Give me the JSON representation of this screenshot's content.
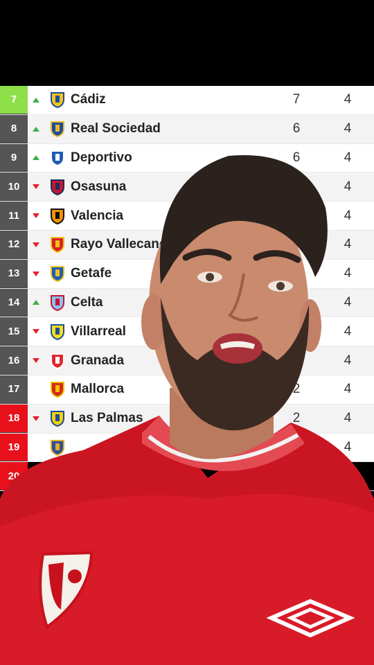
{
  "standings": [
    {
      "pos": "7",
      "trend": "up",
      "team": "Cádiz",
      "pts": "7",
      "pj": "4",
      "zone": "green",
      "crest_color": "#f4c21b",
      "crest_accent": "#1a4e9c"
    },
    {
      "pos": "8",
      "trend": "up",
      "team": "Real Sociedad",
      "pts": "6",
      "pj": "4",
      "zone": "none",
      "crest_color": "#1d4e9e",
      "crest_accent": "#e9b92a"
    },
    {
      "pos": "9",
      "trend": "up",
      "team": "Deportivo",
      "pts": "6",
      "pj": "4",
      "zone": "none",
      "crest_color": "#1d5bb8",
      "crest_accent": "#ffffff"
    },
    {
      "pos": "10",
      "trend": "down",
      "team": "Osasuna",
      "pts": "",
      "pj": "4",
      "zone": "none",
      "crest_color": "#c4162e",
      "crest_accent": "#1b2d5e"
    },
    {
      "pos": "11",
      "trend": "down",
      "team": "Valencia",
      "pts": "",
      "pj": "4",
      "zone": "none",
      "crest_color": "#f39200",
      "crest_accent": "#111111"
    },
    {
      "pos": "12",
      "trend": "down",
      "team": "Rayo Vallecano",
      "pts": "",
      "pj": "4",
      "zone": "none",
      "crest_color": "#d8202c",
      "crest_accent": "#f1c410"
    },
    {
      "pos": "13",
      "trend": "down",
      "team": "Getafe",
      "pts": "",
      "pj": "4",
      "zone": "none",
      "crest_color": "#1f5cb5",
      "crest_accent": "#f0c11e"
    },
    {
      "pos": "14",
      "trend": "up",
      "team": "Celta",
      "pts": "",
      "pj": "4",
      "zone": "none",
      "crest_color": "#8ac2f0",
      "crest_accent": "#c4162e"
    },
    {
      "pos": "15",
      "trend": "down",
      "team": "Villarreal",
      "pts": "",
      "pj": "4",
      "zone": "none",
      "crest_color": "#f7e01a",
      "crest_accent": "#1b4fa0"
    },
    {
      "pos": "16",
      "trend": "down",
      "team": "Granada",
      "pts": "",
      "pj": "4",
      "zone": "none",
      "crest_color": "#e1262f",
      "crest_accent": "#ffffff"
    },
    {
      "pos": "17",
      "trend": "none",
      "team": "Mallorca",
      "pts": "2",
      "pj": "4",
      "zone": "none",
      "crest_color": "#d22a1b",
      "crest_accent": "#f2c200"
    },
    {
      "pos": "18",
      "trend": "down",
      "team": "Las Palmas",
      "pts": "2",
      "pj": "4",
      "zone": "red",
      "crest_color": "#f2d200",
      "crest_accent": "#1d4aa5"
    },
    {
      "pos": "19",
      "trend": "none",
      "team": "",
      "pts": "",
      "pj": "4",
      "zone": "red",
      "crest_color": "#2e4e9e",
      "crest_accent": "#e0b023"
    }
  ],
  "partial_last_row": {
    "pos": "20"
  },
  "colors": {
    "green_zone": "#8ee04a",
    "red_zone": "#e8111b",
    "default_zone": "#555555",
    "shirt": "#d81b28",
    "skin": "#c98a6e",
    "hair": "#2b211d"
  },
  "presenter": {
    "description_icons": [
      "sevilla-badge-icon",
      "umbro-logo-icon"
    ]
  }
}
